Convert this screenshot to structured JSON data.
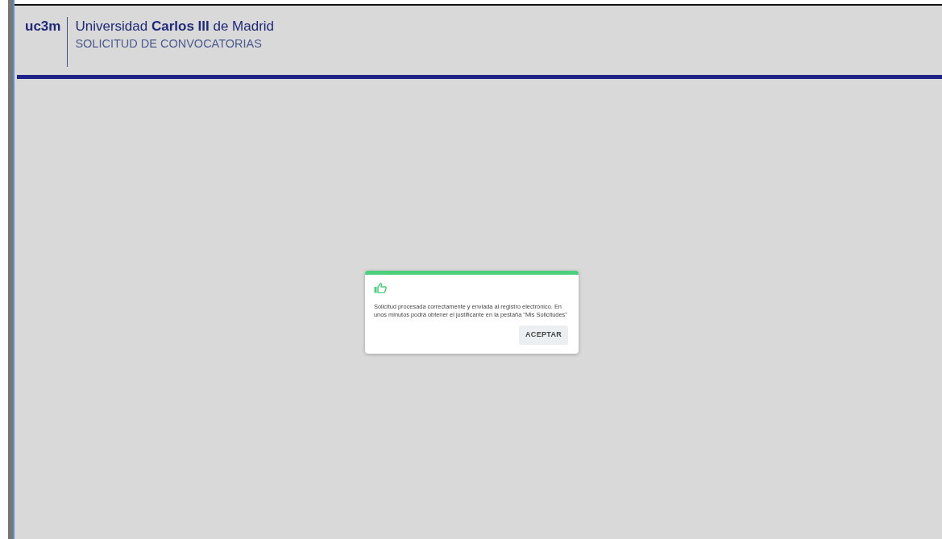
{
  "header": {
    "logo": "uc3m",
    "title": "Universidad **Carlos III** de Madrid",
    "subtitle": "SOLICITUD DE CONVOCATORIAS"
  },
  "dialog": {
    "message": "Solicitud procesada correctamente y enviada al registro electrónico. En unos minutos podrá obtener el justificante en la pestaña \"Mis Solicitudes\"",
    "button": "ACEPTAR"
  }
}
